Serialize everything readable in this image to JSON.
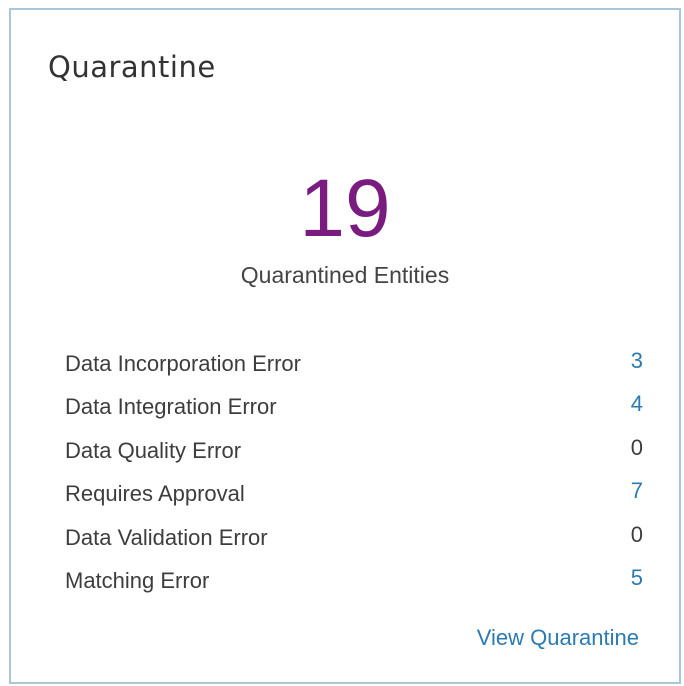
{
  "card": {
    "title": "Quarantine",
    "total": "19",
    "total_label": "Quarantined Entities",
    "accent_color": "#7a1b80",
    "link_color": "#2b7bb0",
    "items": [
      {
        "label": "Data Incorporation Error",
        "count": "3",
        "link": true
      },
      {
        "label": "Data Integration Error",
        "count": "4",
        "link": true
      },
      {
        "label": "Data Quality Error",
        "count": "0",
        "link": false
      },
      {
        "label": "Requires Approval",
        "count": "7",
        "link": true
      },
      {
        "label": "Data Validation Error",
        "count": "0",
        "link": false
      },
      {
        "label": "Matching Error",
        "count": "5",
        "link": true
      }
    ],
    "view_link": "View Quarantine"
  }
}
